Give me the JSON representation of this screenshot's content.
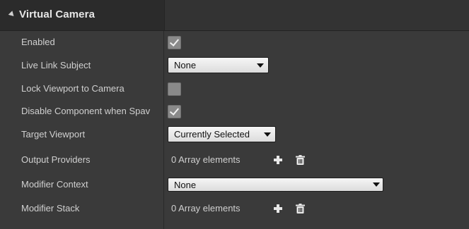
{
  "section": {
    "title": "Virtual Camera"
  },
  "rows": {
    "enabled": {
      "label": "Enabled",
      "checked": true
    },
    "live_link_subject": {
      "label": "Live Link Subject",
      "value": "None"
    },
    "lock_viewport": {
      "label": "Lock Viewport to Camera",
      "checked": false
    },
    "disable_component": {
      "label": "Disable Component when Spav",
      "checked": true
    },
    "target_viewport": {
      "label": "Target Viewport",
      "value": "Currently Selected"
    },
    "output_providers": {
      "label": "Output Providers",
      "value": "0 Array elements"
    },
    "modifier_context": {
      "label": "Modifier Context",
      "value": "None"
    },
    "modifier_stack": {
      "label": "Modifier Stack",
      "value": "0 Array elements"
    }
  },
  "icons": {
    "collapse": "triangle-down-icon",
    "add": "plus-icon",
    "delete": "trash-icon",
    "dropdown": "chevron-down-icon"
  }
}
